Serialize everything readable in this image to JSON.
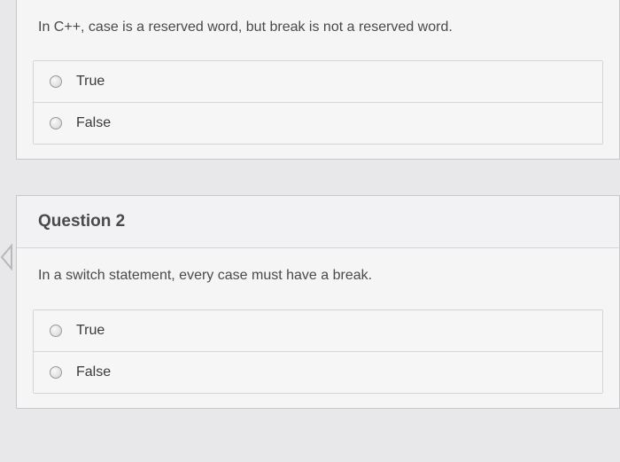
{
  "question1": {
    "prompt": "In C++, case is a reserved word, but break is not a reserved word.",
    "option_true": "True",
    "option_false": "False"
  },
  "question2": {
    "title": "Question 2",
    "prompt": "In a switch statement, every case must have a break.",
    "option_true": "True",
    "option_false": "False"
  }
}
